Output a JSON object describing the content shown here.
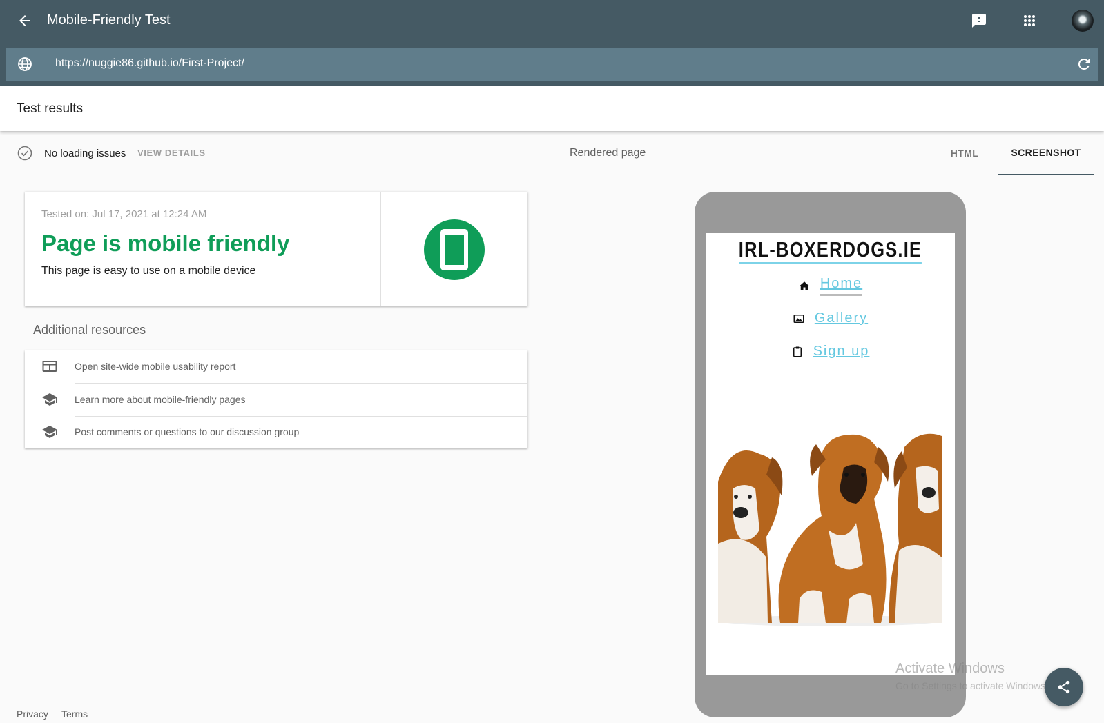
{
  "appbar": {
    "title": "Mobile-Friendly Test",
    "url": "https://nuggie86.github.io/First-Project/"
  },
  "results": {
    "title": "Test results",
    "status_text": "No loading issues",
    "view_details": "VIEW DETAILS"
  },
  "result_card": {
    "tested_on": "Tested on: Jul 17, 2021 at 12:24 AM",
    "verdict": "Page is mobile friendly",
    "subtitle": "This page is easy to use on a mobile device"
  },
  "resources": {
    "title": "Additional resources",
    "items": [
      {
        "label": "Open site-wide mobile usability report",
        "icon": "report-icon"
      },
      {
        "label": "Learn more about mobile-friendly pages",
        "icon": "school-icon"
      },
      {
        "label": "Post comments or questions to our discussion group",
        "icon": "school-icon"
      }
    ]
  },
  "footer": {
    "privacy": "Privacy",
    "terms": "Terms"
  },
  "rendered": {
    "title": "Rendered page",
    "tabs": [
      "HTML",
      "SCREENSHOT"
    ],
    "active_tab": "SCREENSHOT"
  },
  "site": {
    "title": "IRL-BOXERDOGS.IE",
    "nav": [
      {
        "label": "Home",
        "icon": "home-icon"
      },
      {
        "label": "Gallery",
        "icon": "image-icon"
      },
      {
        "label": "Sign up",
        "icon": "clipboard-icon"
      }
    ]
  },
  "watermark": {
    "title": "Activate Windows",
    "subtitle": "Go to Settings to activate Windows."
  },
  "colors": {
    "appbar": "#455a64",
    "urlbar": "#607d8b",
    "success": "#0f9d58",
    "link": "#64c8e0"
  }
}
